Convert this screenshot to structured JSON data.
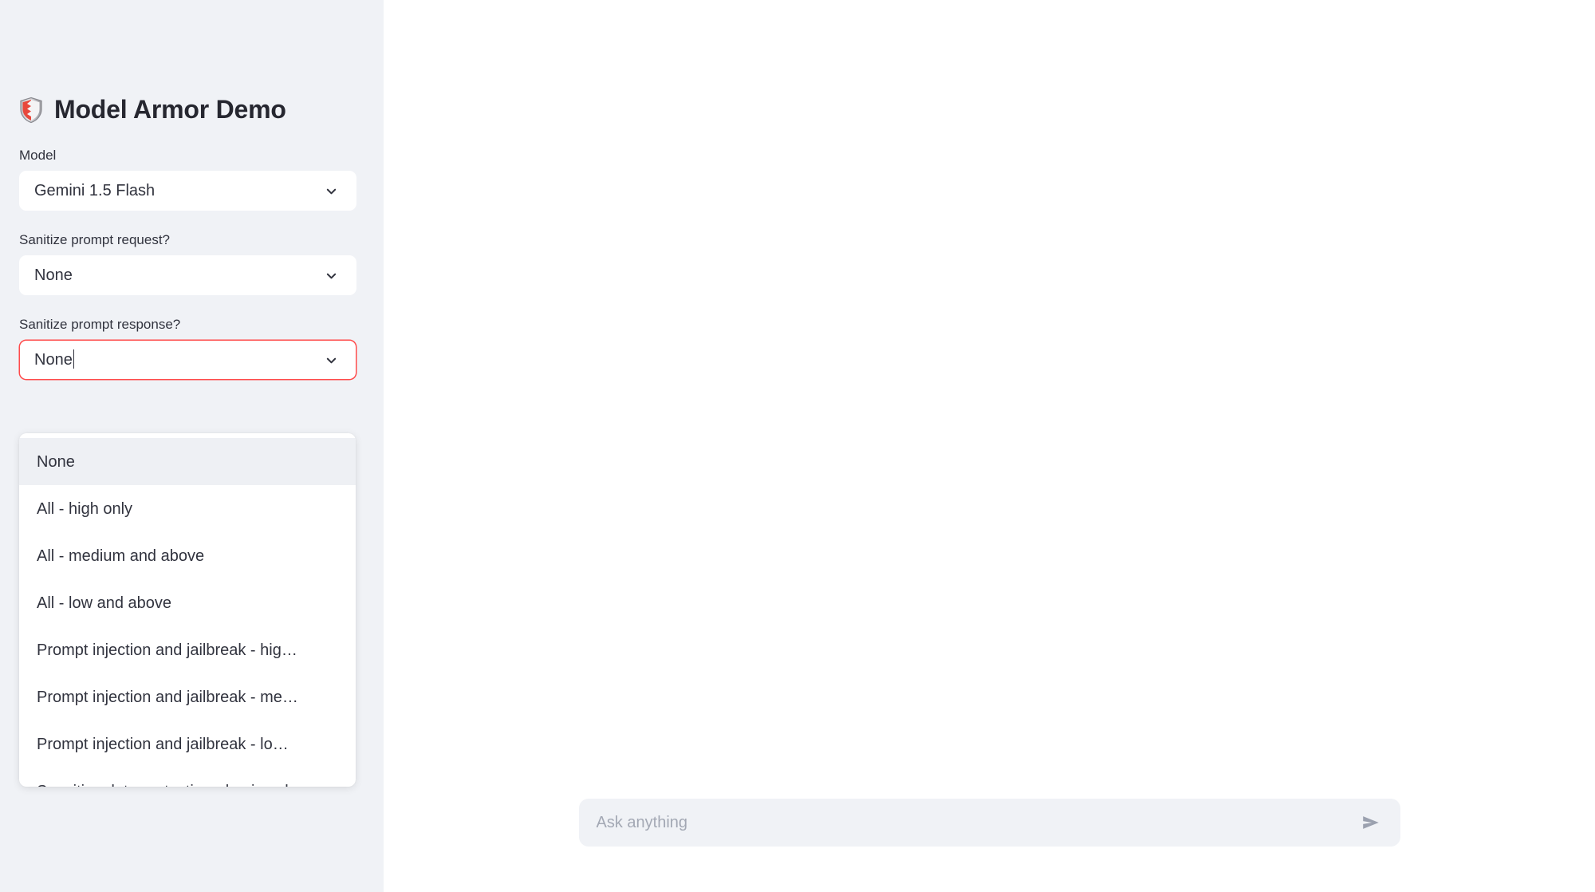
{
  "app": {
    "title": "Model Armor Demo",
    "title_icon": "shield-icon"
  },
  "sidebar": {
    "fields": [
      {
        "label": "Model",
        "value": "Gemini 1.5 Flash",
        "state": "closed",
        "caret_icon": "chevron-down-icon"
      },
      {
        "label": "Sanitize prompt request?",
        "value": "None",
        "state": "closed",
        "caret_icon": "chevron-down-icon"
      },
      {
        "label": "Sanitize prompt response?",
        "value": "None",
        "state": "open-focused",
        "caret_icon": "chevron-down-icon"
      }
    ]
  },
  "dropdown": {
    "owner_label": "Sanitize prompt response?",
    "selected": "None",
    "options": [
      {
        "label": "None",
        "selected": true
      },
      {
        "label": "All - high only",
        "selected": false
      },
      {
        "label": "All - medium and above",
        "selected": false
      },
      {
        "label": "All - low and above",
        "selected": false
      },
      {
        "label": "Prompt injection and jailbreak - hig…",
        "selected": false
      },
      {
        "label": "Prompt injection and jailbreak - me…",
        "selected": false
      },
      {
        "label": "Prompt injection and jailbreak - lo…",
        "selected": false
      },
      {
        "label": "Sensitive data protection - basic only",
        "selected": false
      }
    ]
  },
  "chat": {
    "placeholder": "Ask anything",
    "value": "",
    "send_icon": "send-icon"
  },
  "colors": {
    "sidebar_bg": "#f0f2f6",
    "main_bg": "#ffffff",
    "text": "#31333e",
    "heading": "#262730",
    "focus_border": "#ff4b4b",
    "option_hover": "#eef0f4",
    "placeholder": "#a3a8b4",
    "send_icon": "#9ba1af"
  }
}
